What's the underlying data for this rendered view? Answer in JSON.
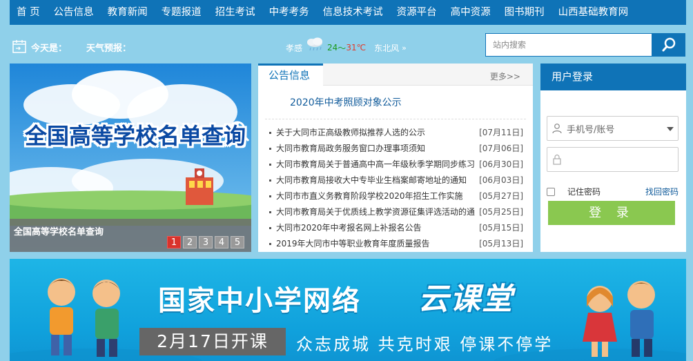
{
  "nav": {
    "items": [
      "首 页",
      "公告信息",
      "教育新闻",
      "专题报道",
      "招生考试",
      "中考考务",
      "信息技术考试",
      "资源平台",
      "高中资源",
      "图书期刊",
      "山西基础教育网"
    ]
  },
  "infobar": {
    "today_label": "今天是：",
    "forecast_label": "天气预报：",
    "weather": {
      "city": "孝感",
      "icon": "rain-cloud-icon",
      "low": "24",
      "sep": "～",
      "high": "31℃",
      "wind": "东北风",
      "arrow": "»"
    }
  },
  "search": {
    "placeholder": "站内搜索"
  },
  "slider": {
    "image_title": "全国高等学校名单查询",
    "caption": "全国高等学校名单查询",
    "pages": [
      "1",
      "2",
      "3",
      "4",
      "5"
    ],
    "active_page": 1
  },
  "notice": {
    "tab": "公告信息",
    "more": "更多>>",
    "headline": "2020年中考照顾对象公示",
    "items": [
      {
        "title": "关于大同市正高级教师拟推荐人选的公示",
        "date": "[07月11日]"
      },
      {
        "title": "大同市教育局政务服务窗口办理事项须知",
        "date": "[07月06日]"
      },
      {
        "title": "大同市教育局关于普通高中高一年级秋季学期同步练习",
        "date": "[06月30日]"
      },
      {
        "title": "大同市教育局接收大中专毕业生档案邮寄地址的通知",
        "date": "[06月03日]"
      },
      {
        "title": "大同市市直义务教育阶段学校2020年招生工作实施",
        "date": "[05月27日]"
      },
      {
        "title": "大同市教育局关于优质线上教学资源征集评选活动的通",
        "date": "[05月25日]"
      },
      {
        "title": "大同市2020年中考报名网上补报名公告",
        "date": "[05月15日]"
      },
      {
        "title": "2019年大同市中等职业教育年度质量报告",
        "date": "[05月13日]"
      }
    ]
  },
  "login": {
    "title": "用户登录",
    "account_placeholder": "手机号/账号",
    "remember": "记住密码",
    "forgot": "找回密码",
    "submit": "登 录"
  },
  "banner": {
    "title": "国家中小学网络",
    "brand": "云课堂",
    "date": "2月17日开课",
    "slogan": "众志成城  共克时艰  停课不停学"
  },
  "colors": {
    "primary": "#0f73b7",
    "page_bg": "#8fd0ea",
    "login_button": "#8ac850",
    "active_dot": "#d9332b"
  }
}
